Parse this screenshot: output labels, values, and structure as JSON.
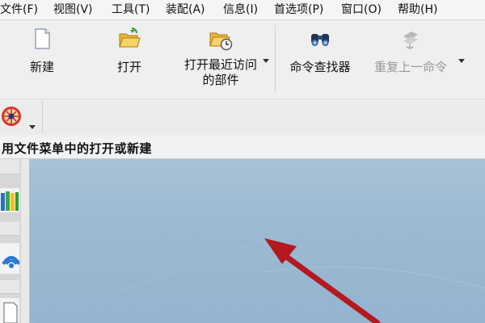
{
  "menubar": {
    "items": [
      "文件(F)",
      "视图(V)",
      "工具(T)",
      "装配(A)",
      "信息(I)",
      "首选项(P)",
      "窗口(O)",
      "帮助(H)"
    ]
  },
  "toolbar": {
    "new_label": "新建",
    "open_label": "打开",
    "open_recent_label_line1": "打开最近访问",
    "open_recent_label_line2": "的部件",
    "command_finder_label": "命令查找器",
    "repeat_last_label": "重复上一命令"
  },
  "hint": {
    "text": "用文件菜单中的打开或新建"
  },
  "colors": {
    "canvas_top": "#a8c2d6",
    "canvas_bottom": "#94b4cf",
    "arrow": "#b3191f"
  }
}
